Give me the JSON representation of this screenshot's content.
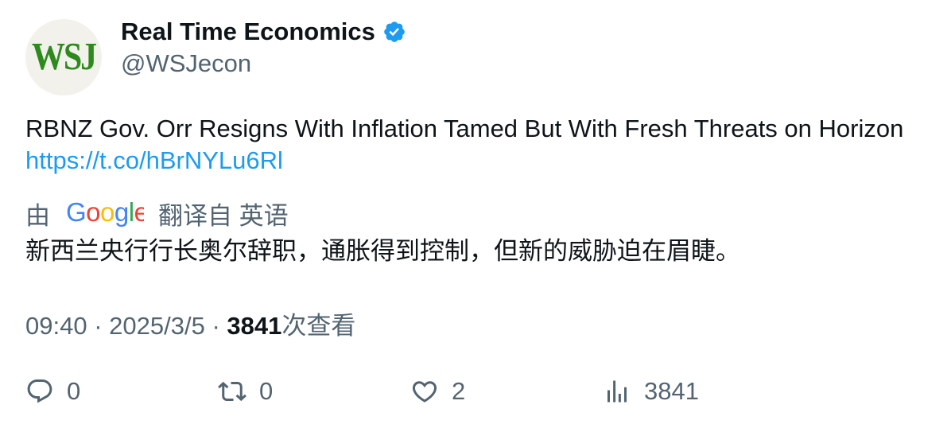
{
  "account": {
    "avatar_text": "WSJ",
    "display_name": "Real Time Economics",
    "handle": "@WSJecon",
    "verified_icon": "verified-badge-icon"
  },
  "tweet": {
    "text": "RBNZ Gov. Orr Resigns With Inflation Tamed But With Fresh Threats on Horizon",
    "link": "https://t.co/hBrNYLu6Rl"
  },
  "translation": {
    "prefix": "由",
    "provider": "Google",
    "suffix": "翻译自 英语",
    "text": "新西兰央行行长奥尔辞职，通胀得到控制，但新的威胁迫在眉睫。"
  },
  "meta": {
    "time": "09:40",
    "separator": "·",
    "date": "2025/3/5",
    "views_count": "3841",
    "views_label": "次查看"
  },
  "actions": {
    "reply_count": "0",
    "retweet_count": "0",
    "like_count": "2",
    "views_count": "3841"
  },
  "colors": {
    "accent": "#1d9bf0",
    "muted": "#536471",
    "text": "#0f1419",
    "logo_green": "#2f8a1e"
  }
}
